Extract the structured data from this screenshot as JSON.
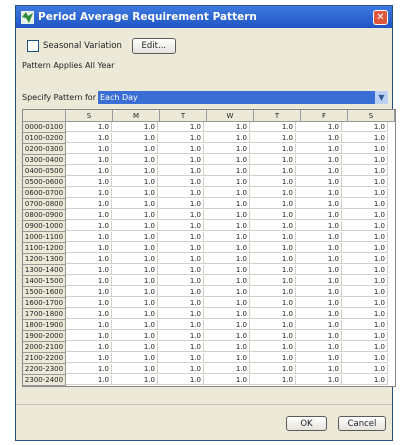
{
  "window": {
    "title": "Period Average Requirement Pattern",
    "close_label": "✕"
  },
  "seasonal": {
    "label": "Seasonal Variation",
    "checked": false,
    "edit_label": "Edit..."
  },
  "applies_label": "Pattern Applies All Year",
  "specify": {
    "label": "Specify Pattern for",
    "value": "Each Day"
  },
  "table": {
    "columns": [
      "S",
      "M",
      "T",
      "W",
      "T",
      "F",
      "S"
    ],
    "rows": [
      {
        "time": "0000-0100",
        "values": [
          "1.0",
          "1.0",
          "1.0",
          "1.0",
          "1.0",
          "1.0",
          "1.0"
        ]
      },
      {
        "time": "0100-0200",
        "values": [
          "1.0",
          "1.0",
          "1.0",
          "1.0",
          "1.0",
          "1.0",
          "1.0"
        ]
      },
      {
        "time": "0200-0300",
        "values": [
          "1.0",
          "1.0",
          "1.0",
          "1.0",
          "1.0",
          "1.0",
          "1.0"
        ]
      },
      {
        "time": "0300-0400",
        "values": [
          "1.0",
          "1.0",
          "1.0",
          "1.0",
          "1.0",
          "1.0",
          "1.0"
        ]
      },
      {
        "time": "0400-0500",
        "values": [
          "1.0",
          "1.0",
          "1.0",
          "1.0",
          "1.0",
          "1.0",
          "1.0"
        ]
      },
      {
        "time": "0500-0600",
        "values": [
          "1.0",
          "1.0",
          "1.0",
          "1.0",
          "1.0",
          "1.0",
          "1.0"
        ]
      },
      {
        "time": "0600-0700",
        "values": [
          "1.0",
          "1.0",
          "1.0",
          "1.0",
          "1.0",
          "1.0",
          "1.0"
        ]
      },
      {
        "time": "0700-0800",
        "values": [
          "1.0",
          "1.0",
          "1.0",
          "1.0",
          "1.0",
          "1.0",
          "1.0"
        ]
      },
      {
        "time": "0800-0900",
        "values": [
          "1.0",
          "1.0",
          "1.0",
          "1.0",
          "1.0",
          "1.0",
          "1.0"
        ]
      },
      {
        "time": "0900-1000",
        "values": [
          "1.0",
          "1.0",
          "1.0",
          "1.0",
          "1.0",
          "1.0",
          "1.0"
        ]
      },
      {
        "time": "1000-1100",
        "values": [
          "1.0",
          "1.0",
          "1.0",
          "1.0",
          "1.0",
          "1.0",
          "1.0"
        ]
      },
      {
        "time": "1100-1200",
        "values": [
          "1.0",
          "1.0",
          "1.0",
          "1.0",
          "1.0",
          "1.0",
          "1.0"
        ]
      },
      {
        "time": "1200-1300",
        "values": [
          "1.0",
          "1.0",
          "1.0",
          "1.0",
          "1.0",
          "1.0",
          "1.0"
        ]
      },
      {
        "time": "1300-1400",
        "values": [
          "1.0",
          "1.0",
          "1.0",
          "1.0",
          "1.0",
          "1.0",
          "1.0"
        ]
      },
      {
        "time": "1400-1500",
        "values": [
          "1.0",
          "1.0",
          "1.0",
          "1.0",
          "1.0",
          "1.0",
          "1.0"
        ]
      },
      {
        "time": "1500-1600",
        "values": [
          "1.0",
          "1.0",
          "1.0",
          "1.0",
          "1.0",
          "1.0",
          "1.0"
        ]
      },
      {
        "time": "1600-1700",
        "values": [
          "1.0",
          "1.0",
          "1.0",
          "1.0",
          "1.0",
          "1.0",
          "1.0"
        ]
      },
      {
        "time": "1700-1800",
        "values": [
          "1.0",
          "1.0",
          "1.0",
          "1.0",
          "1.0",
          "1.0",
          "1.0"
        ]
      },
      {
        "time": "1800-1900",
        "values": [
          "1.0",
          "1.0",
          "1.0",
          "1.0",
          "1.0",
          "1.0",
          "1.0"
        ]
      },
      {
        "time": "1900-2000",
        "values": [
          "1.0",
          "1.0",
          "1.0",
          "1.0",
          "1.0",
          "1.0",
          "1.0"
        ]
      },
      {
        "time": "2000-2100",
        "values": [
          "1.0",
          "1.0",
          "1.0",
          "1.0",
          "1.0",
          "1.0",
          "1.0"
        ]
      },
      {
        "time": "2100-2200",
        "values": [
          "1.0",
          "1.0",
          "1.0",
          "1.0",
          "1.0",
          "1.0",
          "1.0"
        ]
      },
      {
        "time": "2200-2300",
        "values": [
          "1.0",
          "1.0",
          "1.0",
          "1.0",
          "1.0",
          "1.0",
          "1.0"
        ]
      },
      {
        "time": "2300-2400",
        "values": [
          "1.0",
          "1.0",
          "1.0",
          "1.0",
          "1.0",
          "1.0",
          "1.0"
        ]
      }
    ]
  },
  "buttons": {
    "ok": "OK",
    "cancel": "Cancel"
  },
  "colors": {
    "title_bar": "#1f54c4",
    "selection": "#3a6ed4",
    "dialog_bg": "#ece9d8"
  },
  "icons": {
    "app": "spreadsheet-icon",
    "close": "close-icon",
    "dropdown": "chevron-down-icon"
  }
}
